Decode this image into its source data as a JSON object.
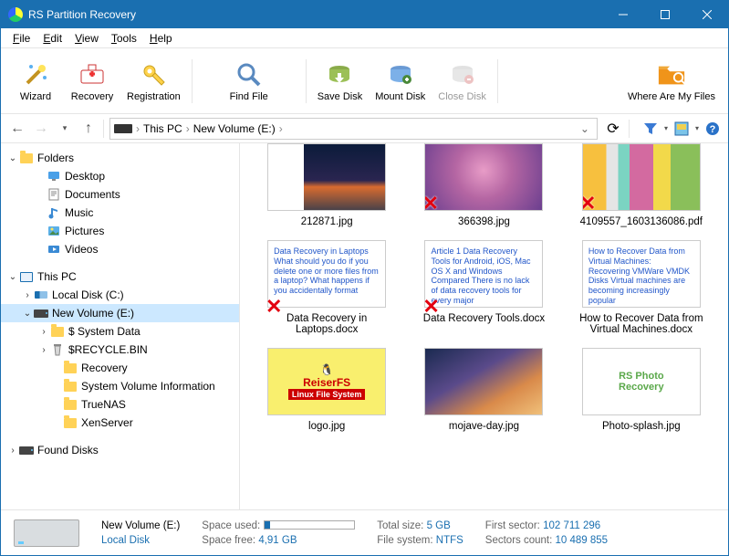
{
  "window": {
    "title": "RS Partition Recovery"
  },
  "menu": {
    "file": "File",
    "edit": "Edit",
    "view": "View",
    "tools": "Tools",
    "help": "Help"
  },
  "toolbar": {
    "wizard": "Wizard",
    "recovery": "Recovery",
    "registration": "Registration",
    "find_file": "Find File",
    "save_disk": "Save Disk",
    "mount_disk": "Mount Disk",
    "close_disk": "Close Disk",
    "where_files": "Where Are My Files"
  },
  "breadcrumb": {
    "pc": "This PC",
    "vol": "New Volume (E:)"
  },
  "sidebar": {
    "folders": "Folders",
    "desktop": "Desktop",
    "documents": "Documents",
    "music": "Music",
    "pictures": "Pictures",
    "videos": "Videos",
    "this_pc": "This PC",
    "local_disk": "Local Disk (C:)",
    "new_volume": "New Volume (E:)",
    "system_data": "$ System Data",
    "recycle": "$RECYCLE.BIN",
    "recovery": "Recovery",
    "svi": "System Volume Information",
    "truenas": "TrueNAS",
    "xenserver": "XenServer",
    "found_disks": "Found Disks"
  },
  "items": {
    "i0": {
      "caption": "212871.jpg"
    },
    "i1": {
      "caption": "366398.jpg"
    },
    "i2": {
      "caption": "4109557_1603136086.pdf"
    },
    "i3": {
      "caption": "Data Recovery in Laptops.docx",
      "preview": "Data Recovery in Laptops\nWhat should you do if you delete one or more files from a laptop? What happens if you accidentally format"
    },
    "i4": {
      "caption": "Data Recovery Tools.docx",
      "preview": "Article 1\nData Recovery Tools for Android, iOS, Mac OS X and Windows Compared\nThere is no lack of data recovery tools for every major"
    },
    "i5": {
      "caption": "How to Recover Data from Virtual Machines.docx",
      "preview": "How to Recover Data from Virtual Machines: Recovering VMWare VMDK Disks\nVirtual machines are becoming increasingly popular"
    },
    "i6": {
      "caption": "logo.jpg"
    },
    "i7": {
      "caption": "mojave-day.jpg"
    },
    "i8": {
      "caption": "Photo-splash.jpg"
    }
  },
  "logo": {
    "line1": "ReiserFS",
    "line2": "Linux File System"
  },
  "splash": {
    "text": "RS Photo\nRecovery"
  },
  "status": {
    "vol_name": "New Volume (E:)",
    "vol_type": "Local Disk",
    "used_label": "Space used:",
    "free_label": "Space free:",
    "free_val": "4,91 GB",
    "total_label": "Total size:",
    "total_val": "5 GB",
    "fs_label": "File system:",
    "fs_val": "NTFS",
    "first_label": "First sector:",
    "first_val": "102 711 296",
    "count_label": "Sectors count:",
    "count_val": "10 489 855"
  }
}
